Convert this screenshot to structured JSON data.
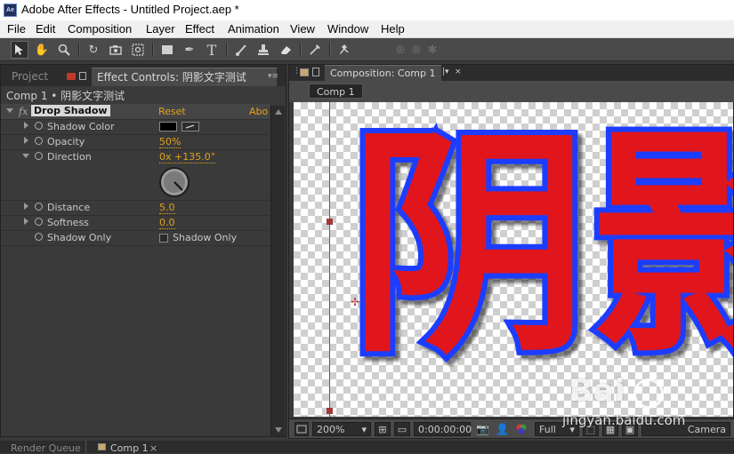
{
  "window": {
    "title": "Adobe After Effects - Untitled Project.aep *",
    "app_icon_label": "Ae"
  },
  "menu": [
    "File",
    "Edit",
    "Composition",
    "Layer",
    "Effect",
    "Animation",
    "View",
    "Window",
    "Help"
  ],
  "toolbar": {
    "tools": [
      "selection-tool",
      "hand-tool",
      "zoom-tool",
      "rotation-tool",
      "camera-tool",
      "pan-behind-tool",
      "rectangle-tool",
      "pen-tool",
      "text-tool",
      "brush-tool",
      "eraser-tool",
      "puppet-tool",
      "pin-tool"
    ]
  },
  "left_panel": {
    "tabs": {
      "project": "Project",
      "effect_controls": "Effect Controls: 阴影文字测试"
    },
    "breadcrumb": "Comp 1 • 阴影文字测试",
    "effect": {
      "fx": "fx",
      "name": "Drop Shadow",
      "reset": "Reset",
      "about": "Abo"
    },
    "properties": {
      "shadow_color": {
        "label": "Shadow Color",
        "swatch": "#000000"
      },
      "opacity": {
        "label": "Opacity",
        "value": "50%"
      },
      "direction": {
        "label": "Direction",
        "value": "0x +135.0°"
      },
      "distance": {
        "label": "Distance",
        "value": "5.0"
      },
      "softness": {
        "label": "Softness",
        "value": "0.0"
      },
      "shadow_only": {
        "label": "Shadow Only",
        "checkbox_label": "Shadow Only",
        "checked": false
      }
    }
  },
  "comp_panel": {
    "tab": "Composition: Comp 1",
    "sub_tab": "Comp 1",
    "canvas_text": "阴影",
    "fill_color": "#e0161e",
    "stroke_color": "#1a3cff",
    "zoom": "200%",
    "timecode": "0:00:00:00",
    "resolution": "Full",
    "view": "Camera"
  },
  "bottom_tabs": {
    "render_queue": "Render Queue",
    "comp1": "Comp 1"
  },
  "watermark": {
    "brand": "Bai",
    "site": "jingyan.baidu.com"
  }
}
